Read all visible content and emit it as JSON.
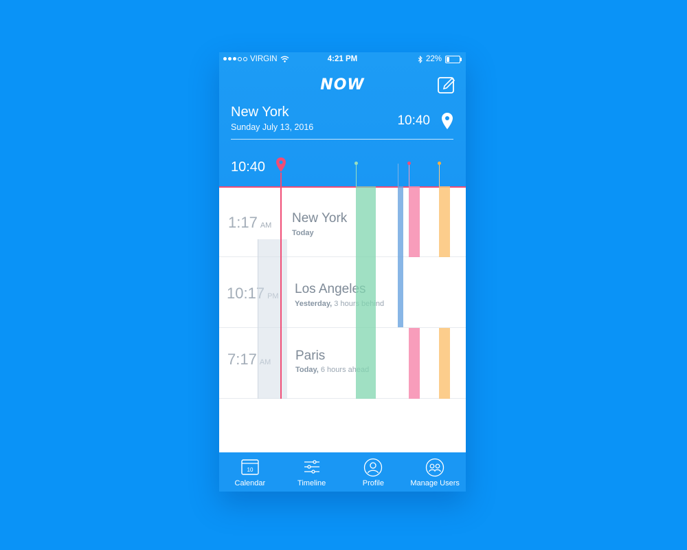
{
  "status_bar": {
    "carrier": "VIRGIN",
    "time": "4:21 PM",
    "battery": "22%",
    "battery_level": 0.22,
    "signal_dots_filled": 3
  },
  "app": {
    "logo": "NOW"
  },
  "location": {
    "city": "New York",
    "date": "Sunday  July 13, 2016",
    "time": "10:40"
  },
  "timeline": {
    "scrub_time": "10:40"
  },
  "cities": [
    {
      "time": "1:17",
      "ampm": "AM",
      "name": "New York",
      "relative": "Today",
      "offset": ""
    },
    {
      "time": "10:17",
      "ampm": "PM",
      "name": "Los Angeles",
      "relative": "Yesterday,",
      "offset": " 3 hours behind"
    },
    {
      "time": "7:17",
      "ampm": "AM",
      "name": "Paris",
      "relative": "Today,",
      "offset": " 6 hours ahead"
    }
  ],
  "tabs": [
    {
      "label": "Calendar",
      "icon": "calendar-icon",
      "badge": "10"
    },
    {
      "label": "Timeline",
      "icon": "sliders-icon"
    },
    {
      "label": "Profile",
      "icon": "user-icon"
    },
    {
      "label": "Manage Users",
      "icon": "users-icon"
    }
  ],
  "colors": {
    "background": "#0a93f7",
    "header": "#1a97f4",
    "current_marker": "#f04d76",
    "green_event": "#9adfbe",
    "blue_event": "#7cb2e6",
    "pink_event": "#f79bb8",
    "orange_event": "#fbc984",
    "grey_event": "#e9edf1"
  }
}
